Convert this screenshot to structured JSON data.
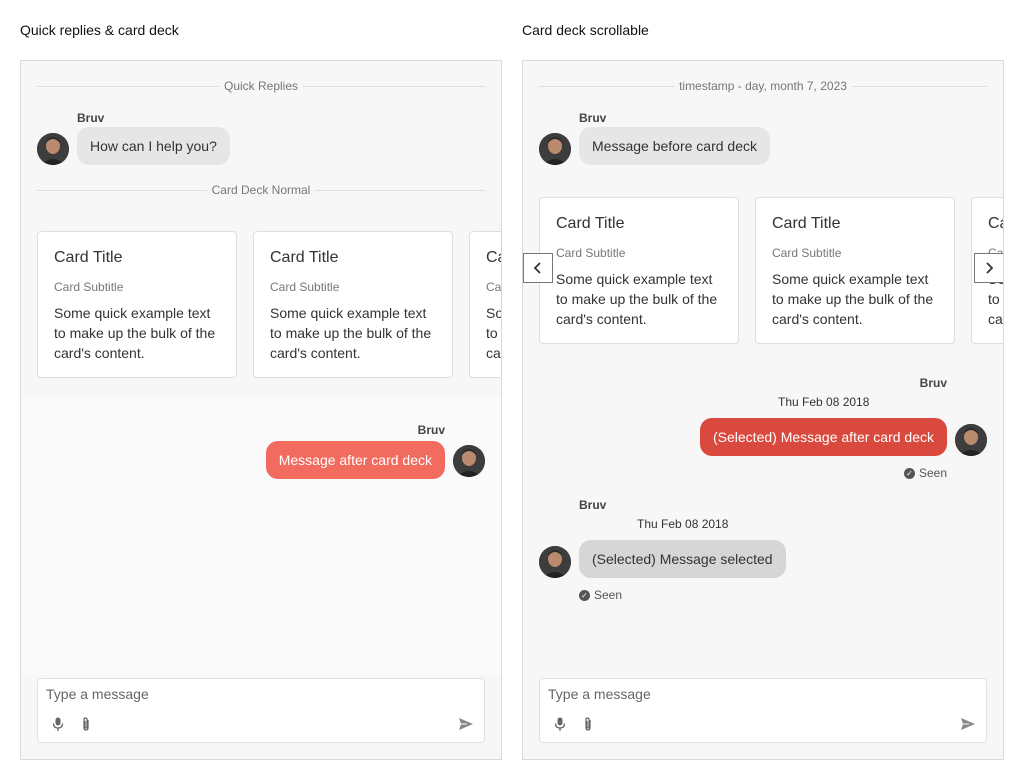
{
  "left": {
    "heading": "Quick replies & card deck",
    "divider_top": "Quick Replies",
    "msg1": {
      "sender": "Bruv",
      "text": "How can I help you?"
    },
    "divider_cards": "Card Deck Normal",
    "cards": [
      {
        "title": "Card Title",
        "subtitle": "Card Subtitle",
        "text": "Some quick example text to make up the bulk of the card's content."
      },
      {
        "title": "Card Title",
        "subtitle": "Card Subtitle",
        "text": "Some quick example text to make up the bulk of the card's content."
      },
      {
        "title": "Card Title",
        "subtitle": "Card Subtitle",
        "text": "Some quick example text to make up the bulk of the card's content."
      }
    ],
    "msg2": {
      "sender": "Bruv",
      "text": "Message after card deck"
    },
    "composer": {
      "placeholder": "Type a message"
    }
  },
  "right": {
    "heading": "Card deck scrollable",
    "divider_top": "timestamp - day, month 7, 2023",
    "msg1": {
      "sender": "Bruv",
      "text": "Message before card deck"
    },
    "cards": [
      {
        "title": "Card Title",
        "subtitle": "Card Subtitle",
        "text": "Some quick example text to make up the bulk of the card's content."
      },
      {
        "title": "Card Title",
        "subtitle": "Card Subtitle",
        "text": "Some quick example text to make up the bulk of the card's content."
      },
      {
        "title": "Card Title",
        "subtitle": "Card Subtitle",
        "text": "Some quick example text to make up the bulk of the card's content."
      }
    ],
    "msg2": {
      "sender": "Bruv",
      "time": "Thu Feb 08 2018",
      "text": "(Selected) Message after card deck",
      "status": "Seen"
    },
    "msg3": {
      "sender": "Bruv",
      "time": "Thu Feb 08 2018",
      "text": "(Selected) Message selected",
      "status": "Seen"
    },
    "composer": {
      "placeholder": "Type a message"
    }
  },
  "icons": {
    "mic": "microphone-icon",
    "attach": "paperclip-icon",
    "send": "send-icon",
    "prev": "chevron-left-icon",
    "next": "chevron-right-icon",
    "seen": "check-circle-icon"
  },
  "colors": {
    "outgoing_bubble": "#f16b5f",
    "outgoing_selected": "#d9493d",
    "incoming_bubble": "#e6e6e6"
  }
}
